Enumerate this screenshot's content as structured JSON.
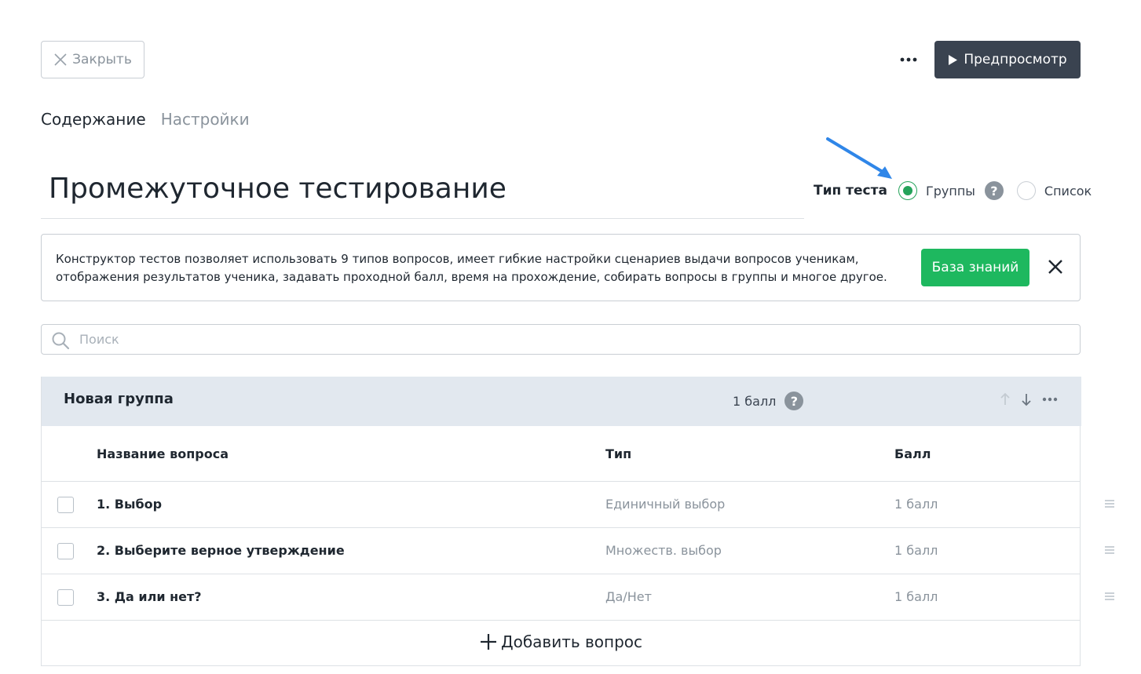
{
  "toolbar": {
    "close_label": "Закрыть",
    "preview_label": "Предпросмотр"
  },
  "tabs": [
    {
      "label": "Содержание",
      "active": true
    },
    {
      "label": "Настройки",
      "active": false
    }
  ],
  "test": {
    "title": "Промежуточное тестирование",
    "type_label": "Тип теста",
    "type_options": [
      {
        "label": "Группы",
        "selected": true
      },
      {
        "label": "Список",
        "selected": false
      }
    ]
  },
  "info": {
    "text": "Конструктор тестов позволяет использовать 9 типов вопросов, имеет гибкие настройки сценариев выдачи вопросов ученикам, отображения результатов ученика, задавать проходной балл, время на прохождение, собирать вопросы в группы и многое другое.",
    "kb_label": "База знаний"
  },
  "search": {
    "placeholder": "Поиск",
    "value": ""
  },
  "group": {
    "name": "Новая группа",
    "score": "1 балл",
    "columns": {
      "name": "Название вопроса",
      "type": "Тип",
      "score": "Балл"
    },
    "questions": [
      {
        "name": "1. Выбор",
        "type": "Единичный выбор",
        "score": "1 балл"
      },
      {
        "name": "2. Выберите верное утверждение",
        "type": "Множеств. выбор",
        "score": "1 балл"
      },
      {
        "name": "3. Да или нет?",
        "type": "Да/Нет",
        "score": "1 балл"
      }
    ],
    "add_label": "Добавить вопрос"
  },
  "colors": {
    "accent_green": "#1eb85f",
    "dark_button": "#3a4350",
    "group_header": "#e2e8ef",
    "arrow_blue": "#2f86e8"
  },
  "icons": {
    "close": "close-x-icon",
    "more": "more-dots-icon",
    "preview": "play-icon",
    "help": "question-icon",
    "search": "search-icon",
    "arrow_up": "arrow-up-icon",
    "arrow_down": "arrow-down-icon",
    "drag": "drag-handle-icon",
    "add": "plus-icon"
  }
}
